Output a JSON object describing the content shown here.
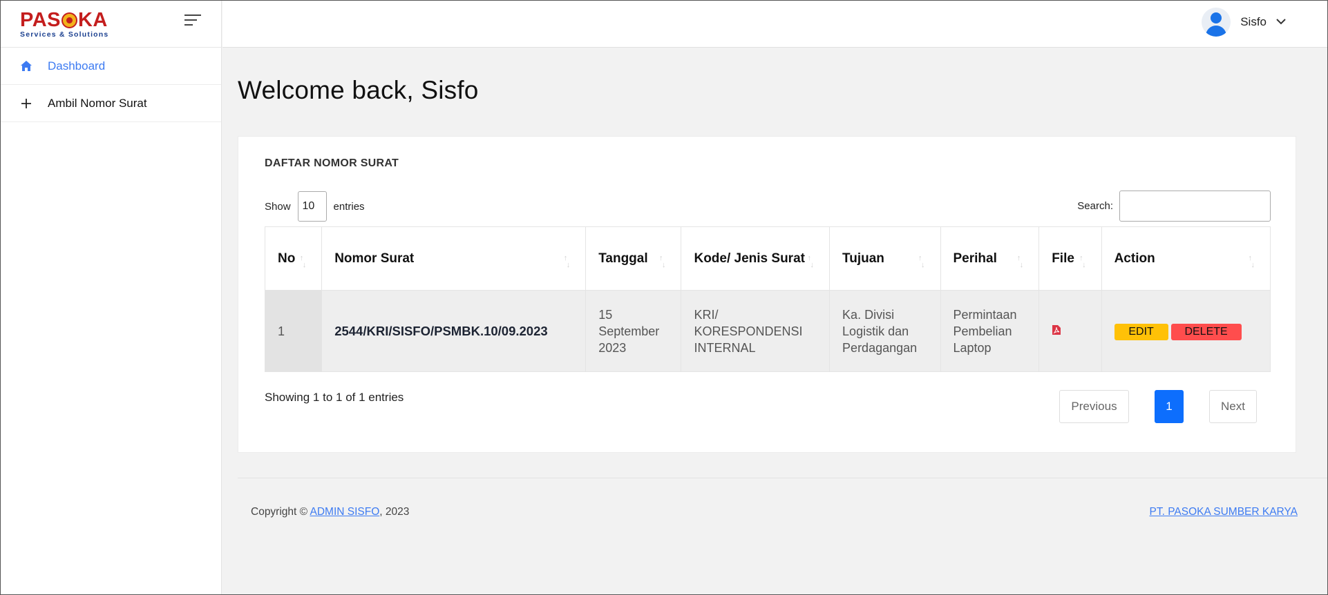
{
  "brand": {
    "logo_word_left": "PAS",
    "logo_word_right": "KA",
    "logo_sub": "Services & Solutions"
  },
  "sidebar": {
    "items": [
      {
        "label": "Dashboard",
        "icon": "home-icon",
        "active": true
      },
      {
        "label": "Ambil Nomor Surat",
        "icon": "plus-icon",
        "active": false
      }
    ]
  },
  "header": {
    "user_name": "Sisfo"
  },
  "main": {
    "welcome": "Welcome back, Sisfo",
    "card_title": "DAFTAR NOMOR SURAT",
    "show_label": "Show",
    "entries_value": "10",
    "entries_label": "entries",
    "search_label": "Search:",
    "table": {
      "headers": [
        "No",
        "Nomor Surat",
        "Tanggal",
        "Kode/ Jenis Surat",
        "Tujuan",
        "Perihal",
        "File",
        "Action"
      ],
      "rows": [
        {
          "no": "1",
          "nomor": "2544/KRI/SISFO/PSMBK.10/09.2023",
          "tanggal": [
            "15",
            "September",
            "2023"
          ],
          "kode": [
            "KRI/",
            "KORESPONDENSI",
            "INTERNAL"
          ],
          "tujuan": [
            "Ka. Divisi",
            "Logistik dan",
            "Perdagangan"
          ],
          "perihal": [
            "Permintaan",
            "Pembelian",
            "Laptop"
          ],
          "file_icon": "pdf-icon",
          "edit_label": "EDIT",
          "delete_label": "DELETE"
        }
      ]
    },
    "info": "Showing 1 to 1 of 1 entries",
    "pager": {
      "previous": "Previous",
      "current": "1",
      "next": "Next"
    }
  },
  "footer": {
    "copyright_prefix": "Copyright © ",
    "copyright_link": "ADMIN SISFO",
    "copyright_suffix": ", 2023",
    "company": "PT. PASOKA SUMBER KARYA"
  },
  "colors": {
    "accent": "#3d7bf2",
    "primary": "#0d6efd",
    "edit": "#ffc107",
    "delete": "#ff4d4d",
    "pdf": "#dc3545"
  }
}
